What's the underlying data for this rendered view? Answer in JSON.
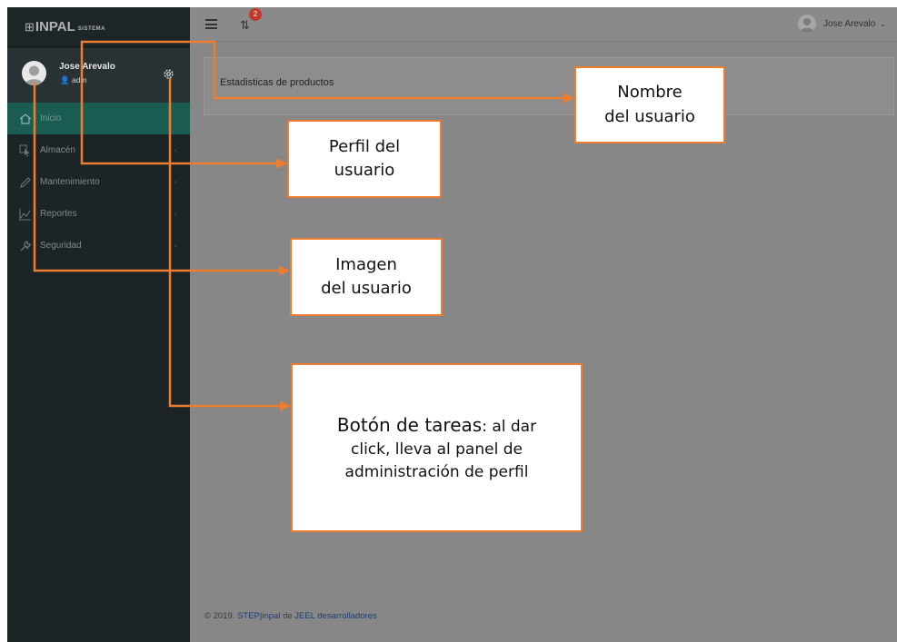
{
  "brand": {
    "name": "INPAL",
    "sub": "SISTEMA"
  },
  "profile": {
    "name": "Jose Arevalo",
    "role": "adm"
  },
  "menu": [
    {
      "label": "Inicio",
      "icon": "home-icon",
      "active": true
    },
    {
      "label": "Almacén",
      "icon": "cursor-icon",
      "active": false
    },
    {
      "label": "Mantenimiento",
      "icon": "pencil-icon",
      "active": false
    },
    {
      "label": "Reportes",
      "icon": "chart-line-icon",
      "active": false
    },
    {
      "label": "Seguridad",
      "icon": "wrench-icon",
      "active": false
    }
  ],
  "topbar": {
    "notification_count": "2",
    "user_name": "Jose Arevalo"
  },
  "panel": {
    "title": "Estadisticas de productos"
  },
  "footer": {
    "prefix": "© 2019.",
    "brand": "STEP|inpal",
    "middle": "de",
    "company": "JEEL desarrolladores"
  },
  "callouts": {
    "nombre": {
      "line1": "Nombre",
      "line2": "del usuario"
    },
    "perfil": {
      "line1": "Perfil del",
      "line2": "usuario"
    },
    "imagen": {
      "line1": "Imagen",
      "line2": "del usuario"
    },
    "boton": {
      "title": "Botón de tareas",
      "rest1": ": al dar",
      "line2": "click, lleva al panel de",
      "line3": "administración de perfil"
    }
  },
  "colors": {
    "accent": "#ed7d31",
    "sidebar": "#1d2426",
    "active": "#1a5c52"
  }
}
